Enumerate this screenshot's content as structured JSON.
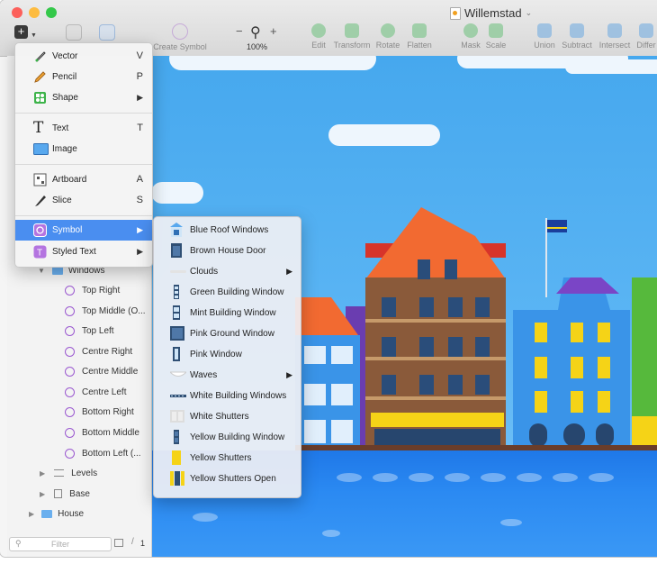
{
  "window": {
    "title": "Willemstad"
  },
  "traffic_lights": {
    "close_color": "#fc605b",
    "minimize_color": "#fdbc40",
    "zoom_color": "#34c84a"
  },
  "toolbar": {
    "create_symbol": "Create Symbol",
    "zoom_minus": "−",
    "zoom_plus": "+",
    "zoom_level": "100%",
    "edit": "Edit",
    "transform": "Transform",
    "rotate": "Rotate",
    "flatten": "Flatten",
    "mask": "Mask",
    "scale": "Scale",
    "union": "Union",
    "subtract": "Subtract",
    "intersect": "Intersect",
    "difference": "Differ"
  },
  "insert_menu": {
    "items": [
      {
        "label": "Vector",
        "shortcut": "V",
        "icon": "vector-pen-icon"
      },
      {
        "label": "Pencil",
        "shortcut": "P",
        "icon": "pencil-icon"
      },
      {
        "label": "Shape",
        "shortcut": "▶",
        "icon": "shape-icon"
      },
      {
        "label": "Text",
        "shortcut": "T",
        "icon": "text-icon"
      },
      {
        "label": "Image",
        "shortcut": "",
        "icon": "image-icon"
      },
      {
        "label": "Artboard",
        "shortcut": "A",
        "icon": "artboard-icon"
      },
      {
        "label": "Slice",
        "shortcut": "S",
        "icon": "slice-icon"
      },
      {
        "label": "Symbol",
        "shortcut": "▶",
        "icon": "symbol-icon"
      },
      {
        "label": "Styled Text",
        "shortcut": "▶",
        "icon": "styled-text-icon"
      }
    ]
  },
  "symbol_submenu": {
    "items": [
      {
        "label": "Blue Roof Windows",
        "has_submenu": false
      },
      {
        "label": "Brown House Door",
        "has_submenu": false
      },
      {
        "label": "Clouds",
        "has_submenu": true
      },
      {
        "label": "Green Building Window",
        "has_submenu": false
      },
      {
        "label": "Mint Building Window",
        "has_submenu": false
      },
      {
        "label": "Pink Ground Window",
        "has_submenu": false
      },
      {
        "label": "Pink Window",
        "has_submenu": false
      },
      {
        "label": "Waves",
        "has_submenu": true
      },
      {
        "label": "White Building Windows",
        "has_submenu": false
      },
      {
        "label": "White Shutters",
        "has_submenu": false
      },
      {
        "label": "Yellow Building Window",
        "has_submenu": false
      },
      {
        "label": "Yellow Shutters",
        "has_submenu": false
      },
      {
        "label": "Yellow Shutters Open",
        "has_submenu": false
      }
    ],
    "arrow": "▶"
  },
  "layers": {
    "group": "Windows",
    "items": [
      "Top Right",
      "Top Middle (O...",
      "Top Left",
      "Centre Right",
      "Centre Middle",
      "Centre Left",
      "Bottom Right",
      "Bottom Middle",
      "Bottom Left (..."
    ],
    "levels": "Levels",
    "base": "Base",
    "house": "House"
  },
  "sidebar_footer": {
    "filter_placeholder": "Filter",
    "count": "1"
  },
  "colors": {
    "accent": "#4a8ef0",
    "sky": "#4aaaf0",
    "water": "#2080ea"
  }
}
